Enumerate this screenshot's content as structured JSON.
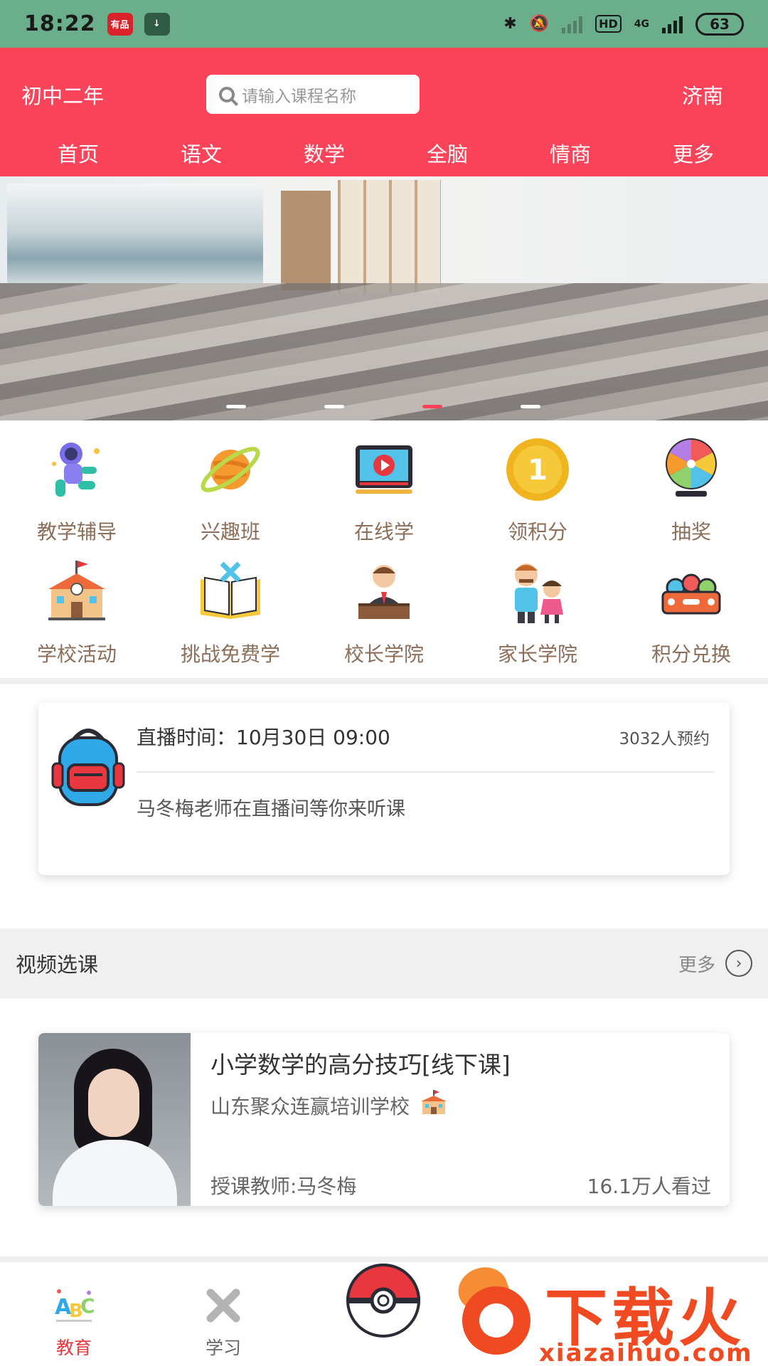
{
  "status_bar": {
    "time": "18:22",
    "app_icon_1": "有品",
    "app_icon_2": "↓",
    "bluetooth": "✱",
    "mute": "🔕",
    "hd": "HD",
    "network": "4G",
    "battery": "63"
  },
  "header": {
    "grade": "初中二年",
    "search_placeholder": "请输入课程名称",
    "city": "济南",
    "tabs": [
      "首页",
      "语文",
      "数学",
      "全脑",
      "情商",
      "更多"
    ],
    "color": "#fb4459"
  },
  "banner": {
    "slide_count": 4,
    "active_index": 2
  },
  "grid": {
    "items": [
      {
        "label": "教学辅导",
        "icon": "astronaut-icon"
      },
      {
        "label": "兴趣班",
        "icon": "planet-icon"
      },
      {
        "label": "在线学",
        "icon": "video-player-icon"
      },
      {
        "label": "领积分",
        "icon": "gold-coin-icon"
      },
      {
        "label": "抽奖",
        "icon": "prize-wheel-icon"
      },
      {
        "label": "学校活动",
        "icon": "school-building-icon"
      },
      {
        "label": "挑战免费学",
        "icon": "open-book-icon"
      },
      {
        "label": "校长学院",
        "icon": "principal-icon"
      },
      {
        "label": "家长学院",
        "icon": "parent-child-icon"
      },
      {
        "label": "积分兑换",
        "icon": "exchange-box-icon"
      }
    ]
  },
  "live": {
    "time_label": "直播时间：10月30日 09:00",
    "reservations": "3032人预约",
    "description": "马冬梅老师在直播间等你来听课",
    "icon": "backpack-icon"
  },
  "section": {
    "title": "视频选课",
    "more": "更多"
  },
  "course": {
    "title": "小学数学的高分技巧[线下课]",
    "school": "山东聚众连赢培训学校",
    "teacher": "授课教师:马冬梅",
    "views": "16.1万人看过"
  },
  "tabbar": {
    "tabs": [
      {
        "label": "教育",
        "icon": "abc-icon",
        "active": true
      },
      {
        "label": "学习",
        "icon": "close-x-icon",
        "active": false
      }
    ],
    "center_icon": "pokeball-icon",
    "active_color": "#e8373f",
    "inactive_color": "#666666"
  },
  "watermark": {
    "brand": "下载火",
    "url": "xiazaihuo.com"
  }
}
